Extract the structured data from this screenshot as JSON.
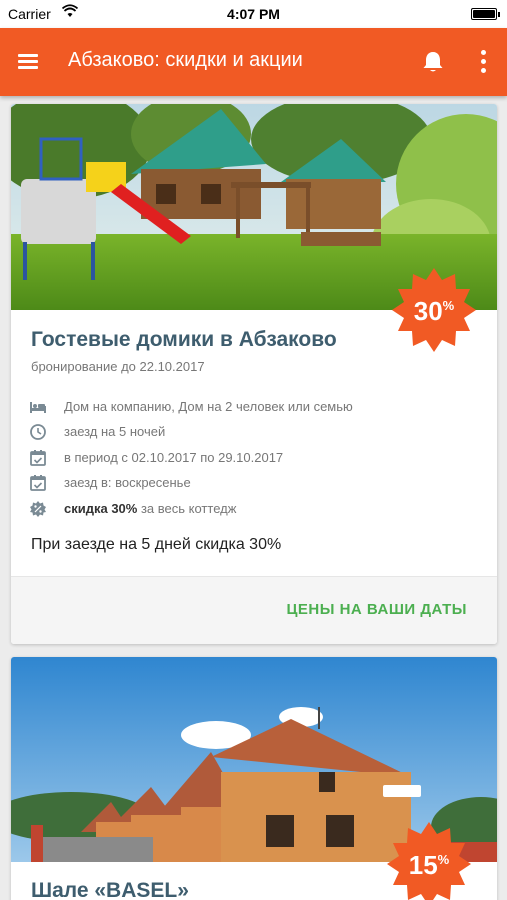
{
  "status_bar": {
    "carrier": "Carrier",
    "time": "4:07 PM"
  },
  "app_bar": {
    "title": "Абзаково: скидки и акции"
  },
  "cards": [
    {
      "title": "Гостевые домики в Абзаково",
      "subtitle": "бронирование до 22.10.2017",
      "discount": "30",
      "discount_unit": "%",
      "info": [
        {
          "icon": "bed-icon",
          "text": "Дом на компанию, Дом на 2 человек или семью"
        },
        {
          "icon": "clock-icon",
          "text": "заезд на 5 ночей"
        },
        {
          "icon": "calendar-check-icon",
          "text": "в период с 02.10.2017 по 29.10.2017"
        },
        {
          "icon": "calendar-check-icon",
          "text": "заезд в: воскресенье"
        },
        {
          "icon": "discount-badge-icon",
          "bold": "скидка 30%",
          "text": " за весь коттедж"
        }
      ],
      "description": "При заезде на 5 дней скидка 30%",
      "cta": "ЦЕНЫ НА ВАШИ ДАТЫ"
    },
    {
      "title": "Шале «BASEL»",
      "discount": "15",
      "discount_unit": "%"
    }
  ],
  "colors": {
    "accent": "#f15a24",
    "title": "#3e5d6e",
    "cta": "#4caf50"
  }
}
